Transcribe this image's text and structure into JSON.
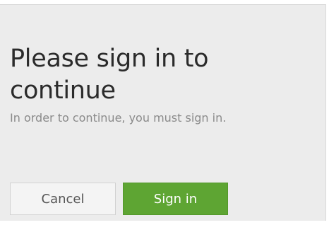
{
  "dialog": {
    "title": "Please sign in to continue",
    "message": "In order to continue, you must sign in.",
    "buttons": {
      "cancel_label": "Cancel",
      "signin_label": "Sign in"
    }
  },
  "colors": {
    "panel_background": "#ececec",
    "primary_button": "#5ea533",
    "secondary_button": "#f4f4f4"
  }
}
